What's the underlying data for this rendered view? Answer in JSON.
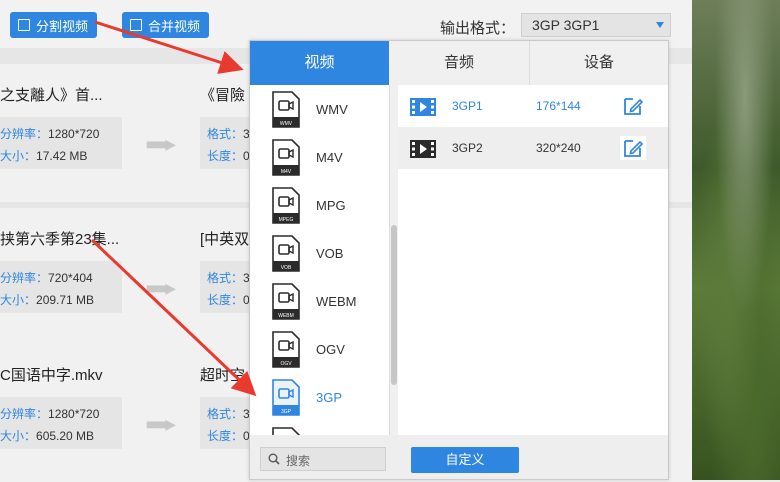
{
  "toolbar": {
    "split_label": "分割视频",
    "merge_label": "合并视频",
    "output_format_label": "输出格式：",
    "output_format_value": "3GP  3GP1"
  },
  "files": [
    {
      "title": "之支離人》首...",
      "title2": "《冒險",
      "res_label": "分辨率：",
      "res_value": "1280*720",
      "size_label": "大小：",
      "size_value": "17.42 MB",
      "fmt_label": "格式：",
      "fmt_value": "3",
      "len_label": "长度：",
      "len_value": "0"
    },
    {
      "title": "挟第六季第23集...",
      "title2": "[中英双",
      "res_label": "分辨率：",
      "res_value": "720*404",
      "size_label": "大小：",
      "size_value": "209.71 MB",
      "fmt_label": "格式：",
      "fmt_value": "3",
      "len_label": "长度：",
      "len_value": "0"
    },
    {
      "title": "C国语中字.mkv",
      "title2": "超时空",
      "res_label": "分辨率：",
      "res_value": "1280*720",
      "size_label": "大小：",
      "size_value": "605.20 MB",
      "fmt_label": "格式：",
      "fmt_value": "3",
      "len_label": "长度：",
      "len_value": "0"
    }
  ],
  "popup": {
    "tabs": [
      "视频",
      "音频",
      "设备"
    ],
    "formats": [
      {
        "name": "WMV",
        "tag": "WMV"
      },
      {
        "name": "M4V",
        "tag": "M4V"
      },
      {
        "name": "MPG",
        "tag": "MPEG"
      },
      {
        "name": "VOB",
        "tag": "VOB"
      },
      {
        "name": "WEBM",
        "tag": "WEBM"
      },
      {
        "name": "OGV",
        "tag": "OGV"
      },
      {
        "name": "3GP",
        "tag": "3GP"
      }
    ],
    "active_format": "3GP",
    "presets": [
      {
        "name": "3GP1",
        "resolution": "176*144"
      },
      {
        "name": "3GP2",
        "resolution": "320*240"
      }
    ],
    "search_placeholder": "搜索",
    "custom_label": "自定义"
  },
  "colors": {
    "accent": "#2f86e0",
    "annotation_arrow": "#e83a2e"
  }
}
